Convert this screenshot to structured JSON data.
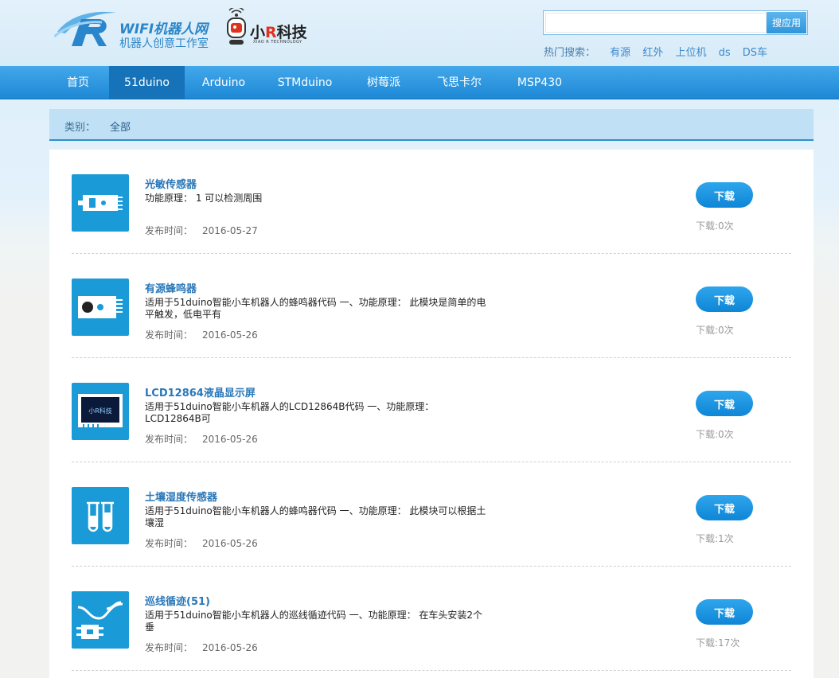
{
  "header": {
    "logo1": {
      "brand": "WIFI机器人网",
      "tagline": "机器人创意工作室"
    },
    "logo2": {
      "brand_prefix": "小",
      "brand_mid": "R",
      "brand_suffix": "科技",
      "sub": "XIAO R TECHNOLOGY"
    },
    "search": {
      "placeholder": "",
      "button_label": "搜应用"
    },
    "hot_search": {
      "label": "热门搜索：",
      "terms": [
        "有源",
        "红外",
        "上位机",
        "ds",
        "DS车"
      ]
    }
  },
  "nav": {
    "items": [
      {
        "label": "首页",
        "active": false
      },
      {
        "label": "51duino",
        "active": true
      },
      {
        "label": "Arduino",
        "active": false
      },
      {
        "label": "STMduino",
        "active": false
      },
      {
        "label": "树莓派",
        "active": false
      },
      {
        "label": "飞思卡尔",
        "active": false
      },
      {
        "label": "MSP430",
        "active": false
      }
    ]
  },
  "category": {
    "label": "类别：",
    "value": "全部"
  },
  "list": {
    "date_label": "发布时间：",
    "download_label": "下载",
    "items": [
      {
        "title": "光敏传感器",
        "desc": "功能原理：                 1 可以检测周围",
        "date": "2016-05-27",
        "downloads": "下载:0次",
        "icon": "light-sensor-icon"
      },
      {
        "title": "有源蜂鸣器",
        "desc": "适用于51duino智能小车机器人的蜂鸣器代码 一、功能原理：        此模块是简单的电平触发，低电平有",
        "date": "2016-05-26",
        "downloads": "下载:0次",
        "icon": "buzzer-icon"
      },
      {
        "title": "LCD12864液晶显示屏",
        "desc": "适用于51duino智能小车机器人的LCD12864B代码 一、功能原理：            LCD12864B可",
        "date": "2016-05-26",
        "downloads": "下载:0次",
        "icon": "lcd-screen-icon"
      },
      {
        "title": "土壤湿度传感器",
        "desc": "适用于51duino智能小车机器人的蜂鸣器代码 一、功能原理：          此模块可以根据土壤湿",
        "date": "2016-05-26",
        "downloads": "下载:1次",
        "icon": "test-tube-icon"
      },
      {
        "title": "巡线循迹(51)",
        "desc": "适用于51duino智能小车机器人的巡线循迹代码 一、功能原理：          在车头安装2个垂",
        "date": "2016-05-26",
        "downloads": "下载:17次",
        "icon": "line-tracking-icon"
      }
    ]
  }
}
